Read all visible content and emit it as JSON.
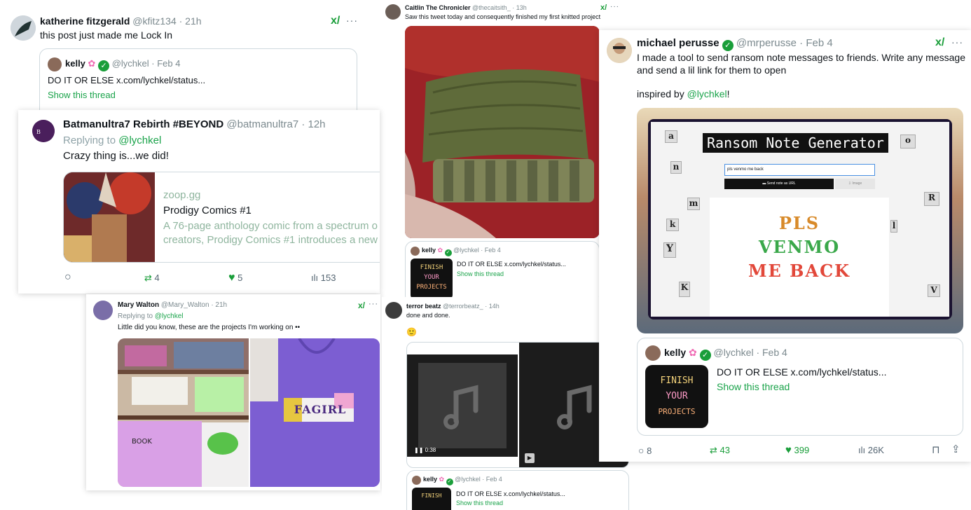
{
  "t1": {
    "name": "katherine fitzgerald",
    "handle": "@kfitz134 · 21h",
    "text": "this post just made me Lock In",
    "quote": {
      "name": "kelly",
      "handle": "@lychkel · Feb 4",
      "text": "DO IT OR ELSE  x.com/lychkel/status...",
      "link": "Show this thread"
    }
  },
  "t2": {
    "name": "Batmanultra7 Rebirth #BEYOND",
    "handle": "@batmanultra7 · 12h",
    "replying_prefix": "Replying to ",
    "replying_to": "@lychkel",
    "text": "Crazy thing is...we did!",
    "link_card": {
      "domain": "zoop.gg",
      "title": "Prodigy Comics #1",
      "desc_line1": "A 76-page anthology comic from a spectrum o",
      "desc_line2": "creators, Prodigy Comics #1 introduces a new"
    },
    "retweets": "4",
    "likes": "5",
    "views": "153"
  },
  "t3": {
    "name": "Caitlin The Chronicler",
    "handle": "@thecaitsith_ · 13h",
    "text": "Saw this tweet today and consequently finished my first knitted project",
    "quote": {
      "name": "kelly",
      "handle": "@lychkel · Feb 4",
      "text": "DO IT OR ELSE  x.com/lychkel/status...",
      "link": "Show this thread"
    }
  },
  "t4": {
    "name": "michael perusse",
    "handle": "@mrperusse · Feb 4",
    "text_line1": "I made a tool to send ransom note messages to friends. Write any message",
    "text_line2": "and send a lil link for them to open",
    "inspired_prefix": "inspired by ",
    "inspired_link": "@lychkel",
    "inspired_suffix": "!",
    "screenshot": {
      "title": "Ransom Note Generator",
      "input_value": "pls venmo me back",
      "send_button": "Send note as URL",
      "image_button": "Image",
      "note_line1": "PLS",
      "note_line2": "VENMO",
      "note_line3": "ME BACK"
    },
    "quote": {
      "name": "kelly",
      "handle": "@lychkel · Feb 4",
      "text": "DO IT OR ELSE  x.com/lychkel/status...",
      "link": "Show this thread"
    },
    "replies": "8",
    "retweets": "43",
    "likes": "399",
    "views": "26K"
  },
  "t5": {
    "name": "Mary Walton",
    "handle": "@Mary_Walton · 21h",
    "replying_prefix": "Replying to ",
    "replying_to": "@lychkel",
    "text": "Little did you know, these are the projects I'm working on ••",
    "shirt_text": "FAGIRL"
  },
  "t6": {
    "name": "terror beatz",
    "handle": "@terrorbeatz_ · 14h",
    "text": "done and done.",
    "emoji": "🙂",
    "video_time": "0:38",
    "quote": {
      "name": "kelly",
      "handle": "@lychkel · Feb 4",
      "text": "DO IT OR ELSE  x.com/lychkel/status...",
      "link": "Show this thread"
    }
  },
  "ransom_image": {
    "line1": "FINISH",
    "line2": "YOUR",
    "line3": "PROJECTS"
  },
  "icons": {
    "x_logo": "x⃥",
    "more": "···"
  }
}
